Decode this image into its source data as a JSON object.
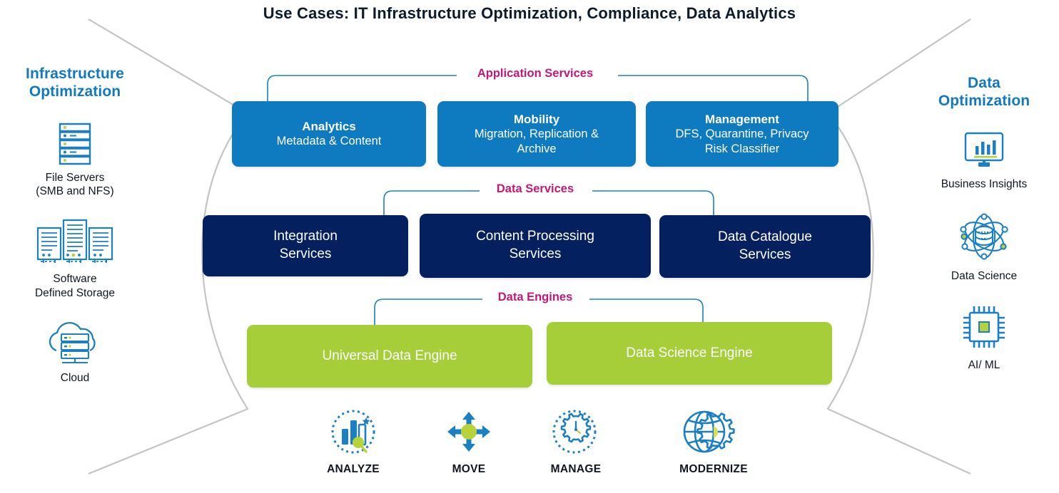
{
  "title": "Use Cases: IT Infrastructure Optimization, Compliance, Data Analytics",
  "colors": {
    "app_services_box": "#0e7ac0",
    "data_services_box": "#05205e",
    "data_engines_box": "#a6ce39",
    "group_label": "#c2187a",
    "side_heading": "#1379bf",
    "icon_blue": "#1b7fc4",
    "icon_green": "#b6d43a",
    "bracket": "#c4c4c4",
    "body_text": "#10161f"
  },
  "left": {
    "heading": "Infrastructure\nOptimization",
    "heading_line1": "Infrastructure",
    "heading_line2": "Optimization",
    "items": [
      {
        "icon": "server-stack-icon",
        "label_line1": "File Servers",
        "label_line2": "(SMB and NFS)"
      },
      {
        "icon": "server-racks-icon",
        "label_line1": "Software",
        "label_line2": "Defined Storage"
      },
      {
        "icon": "cloud-servers-icon",
        "label_line1": "Cloud",
        "label_line2": ""
      }
    ]
  },
  "right": {
    "heading_line1": "Data",
    "heading_line2": "Optimization",
    "items": [
      {
        "icon": "monitor-bar-chart-icon",
        "label_line1": "Business Insights",
        "label_line2": ""
      },
      {
        "icon": "atom-database-icon",
        "label_line1": "Data Science",
        "label_line2": ""
      },
      {
        "icon": "cpu-chip-icon",
        "label_line1": "AI/ ML",
        "label_line2": ""
      }
    ]
  },
  "groups": [
    {
      "label": "Application Services",
      "boxes": [
        {
          "title": "Analytics",
          "sub": "Metadata & Content"
        },
        {
          "title": "Mobility",
          "sub": "Migration, Replication &\nArchive"
        },
        {
          "title": "Management",
          "sub": "DFS, Quarantine, Privacy\nRisk Classifier"
        }
      ]
    },
    {
      "label": "Data Services",
      "boxes": [
        {
          "title": "",
          "sub": "Integration\nServices"
        },
        {
          "title": "",
          "sub": "Content Processing\nServices"
        },
        {
          "title": "",
          "sub": "Data Catalogue\nServices"
        }
      ]
    },
    {
      "label": "Data Engines",
      "boxes": [
        {
          "title": "",
          "sub": "Universal Data Engine"
        },
        {
          "title": "",
          "sub": "Data Science Engine"
        }
      ]
    }
  ],
  "app_services": {
    "label": "Application Services",
    "box1_title": "Analytics",
    "box1_sub": "Metadata & Content",
    "box2_title": "Mobility",
    "box2_sub_line1": "Migration, Replication &",
    "box2_sub_line2": "Archive",
    "box3_title": "Management",
    "box3_sub_line1": "DFS, Quarantine, Privacy",
    "box3_sub_line2": "Risk Classifier"
  },
  "data_services": {
    "label": "Data Services",
    "box1_line1": "Integration",
    "box1_line2": "Services",
    "box2_line1": "Content Processing",
    "box2_line2": "Services",
    "box3_line1": "Data Catalogue",
    "box3_line2": "Services"
  },
  "data_engines": {
    "label": "Data Engines",
    "box1": "Universal Data Engine",
    "box2": "Data Science Engine"
  },
  "bottom": [
    {
      "icon": "analyze-chart-icon",
      "label": "ANALYZE"
    },
    {
      "icon": "move-arrows-icon",
      "label": "MOVE"
    },
    {
      "icon": "manage-gear-clock-icon",
      "label": "MANAGE"
    },
    {
      "icon": "modernize-globe-gear-icon",
      "label": "MODERNIZE"
    }
  ]
}
